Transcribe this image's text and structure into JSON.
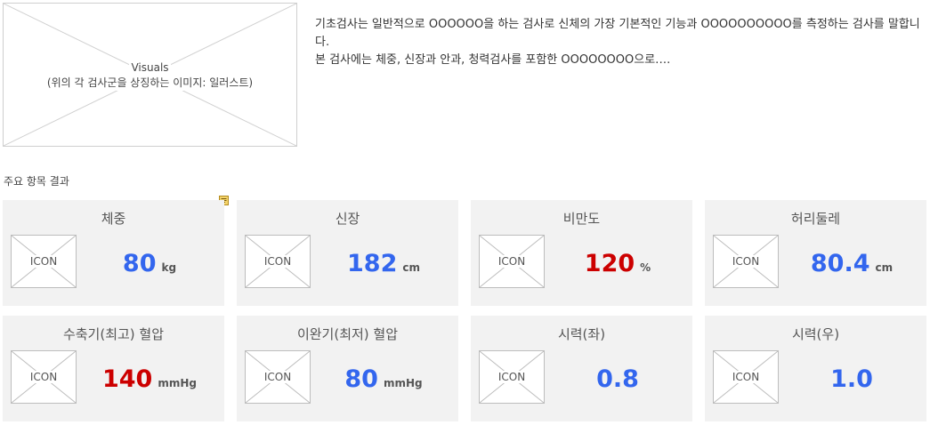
{
  "visual": {
    "line1": "Visuals",
    "line2": "(위의 각 검사군을 상징하는 이미지: 일러스트)"
  },
  "intro": {
    "line1": "기초검사는 일반적으로 OOOOOO을 하는 검사로 신체의 가장 기본적인 기능과 OOOOOOOOOO를 측정하는 검사를 말합니다.",
    "line2": "본 검사에는 체중, 신장과 안과, 청력검사를 포함한 OOOOOOOO으로…."
  },
  "section": {
    "title": "주요 항목 결과"
  },
  "icon_label": "ICON",
  "note_icon": "note-icon",
  "colors": {
    "normal": "#3366ee",
    "alert": "#cc0000",
    "card_bg": "#f2f2f2"
  },
  "cards": [
    {
      "title": "체중",
      "value": "80",
      "unit": "kg",
      "status": "normal"
    },
    {
      "title": "신장",
      "value": "182",
      "unit": "cm",
      "status": "normal"
    },
    {
      "title": "비만도",
      "value": "120",
      "unit": "%",
      "status": "alert"
    },
    {
      "title": "허리둘레",
      "value": "80.4",
      "unit": "cm",
      "status": "normal"
    },
    {
      "title": "수축기(최고) 혈압",
      "value": "140",
      "unit": "mmHg",
      "status": "alert"
    },
    {
      "title": "이완기(최저) 혈압",
      "value": "80",
      "unit": "mmHg",
      "status": "normal"
    },
    {
      "title": "시력(좌)",
      "value": "0.8",
      "unit": "",
      "status": "normal"
    },
    {
      "title": "시력(우)",
      "value": "1.0",
      "unit": "",
      "status": "normal"
    }
  ]
}
